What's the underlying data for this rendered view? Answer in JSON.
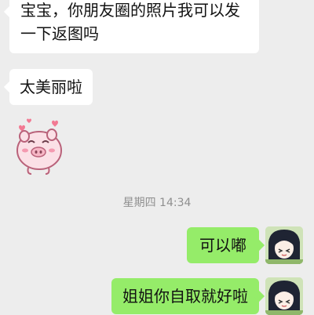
{
  "messages": {
    "msg1": "宝宝，你朋友圈的照片我可以发一下返图吗",
    "msg2": "太美丽啦",
    "msg3": "可以嘟",
    "msg4": "姐姐你自取就好啦"
  },
  "timestamp": "星期四 14:34",
  "colors": {
    "background": "#ededed",
    "incoming_bubble": "#ffffff",
    "outgoing_bubble": "#95ec69",
    "timestamp_text": "#8f8f8f"
  }
}
